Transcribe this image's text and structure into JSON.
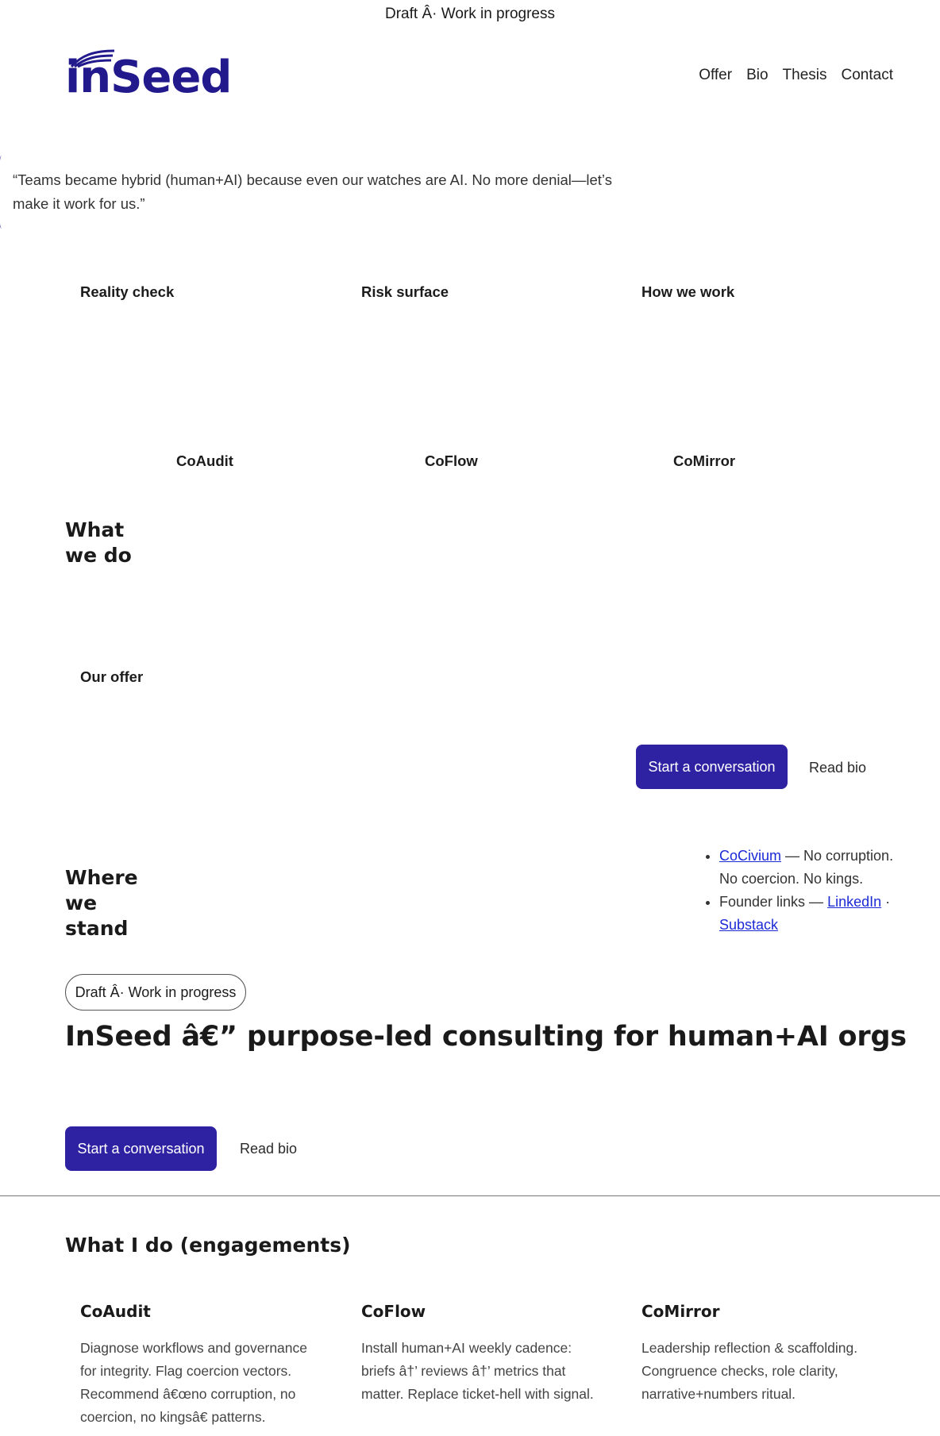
{
  "banner": {
    "text": "Draft Â· Work in progress"
  },
  "logo": {
    "text": "inSeed"
  },
  "nav": {
    "items": [
      "Offer",
      "Bio",
      "Thesis",
      "Contact"
    ]
  },
  "quote": {
    "text": "“Teams became hybrid (human+AI) because even our watches are AI. No more denial—let’s make it work for us.”"
  },
  "cards_row1": [
    "Reality check",
    "Risk surface",
    "How we work"
  ],
  "products_row": [
    "CoAudit",
    "CoFlow",
    "CoMirror"
  ],
  "what_we_do": {
    "heading": "What we do"
  },
  "offer": {
    "title": "Our offer"
  },
  "cta_mid": {
    "primary": "Start a conversation",
    "secondary": "Read bio"
  },
  "where_we_stand": {
    "heading": "Where we stand",
    "items": [
      {
        "link": "CoCivium",
        "text": " — No corruption. No coercion. No kings."
      },
      {
        "prefix": "Founder links — ",
        "link1": "LinkedIn",
        "sep": " · ",
        "link2": "Substack"
      }
    ]
  },
  "hero": {
    "badge": "Draft Â· Work in progress",
    "title": "InSeed â€” purpose-led consulting for human+AI orgs",
    "cta_primary": "Start a conversation",
    "cta_secondary": "Read bio"
  },
  "engagements": {
    "heading": "What I do (engagements)",
    "items": [
      {
        "title": "CoAudit",
        "body": "Diagnose workflows and governance for integrity. Flag coercion vectors. Recommend â€œno corruption, no coercion, no kingsâ€ patterns."
      },
      {
        "title": "CoFlow",
        "body": "Install human+AI weekly cadence: briefs â†’ reviews â†’ metrics that matter. Replace ticket-hell with signal."
      },
      {
        "title": "CoMirror",
        "body": "Leadership reflection & scaffolding. Congruence checks, role clarity, narrative+numbers ritual."
      }
    ]
  },
  "colors": {
    "accent": "#2e22a3",
    "logo": "#221a8c",
    "link": "#1c2ad6"
  }
}
